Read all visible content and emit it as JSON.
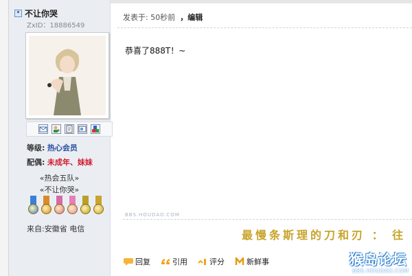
{
  "user": {
    "name": "不让你哭",
    "zxid": "ZxID：18886549"
  },
  "profile": {
    "level_label": "等级:",
    "level_value": "热心会员",
    "spouse_label": "配偶:",
    "spouse_value": "未成年、妹妹",
    "team_line1": "«热会五队»",
    "team_line2": "«不让你哭»",
    "from": "来自:安徽省 电信",
    "medal_colors": [
      "#3b7fd6",
      "#d98b2b",
      "#d66aa8",
      "#e77fb6",
      "#b8a02a",
      "#c9a431"
    ]
  },
  "post": {
    "meta_posted": "发表于: 50秒前",
    "meta_edit": "，编辑",
    "content": "恭喜了888T！~",
    "watermark": "BBS.HOUDAO.COM",
    "signature": "最慢条斯理的刀和刃 ： 往"
  },
  "toolbar": {
    "reply": "回复",
    "quote": "引用",
    "rate": "评分",
    "fresh": "新鲜事"
  },
  "logo": {
    "line1": "猴岛论坛",
    "line2": "BBS.HOUDAO.COM"
  },
  "icons": {
    "user": "user-icon",
    "mail": "mail-icon",
    "add_friend": "add-friend-icon",
    "profile": "profile-card-icon",
    "blog": "blog-icon",
    "app": "app-blocks-icon"
  }
}
